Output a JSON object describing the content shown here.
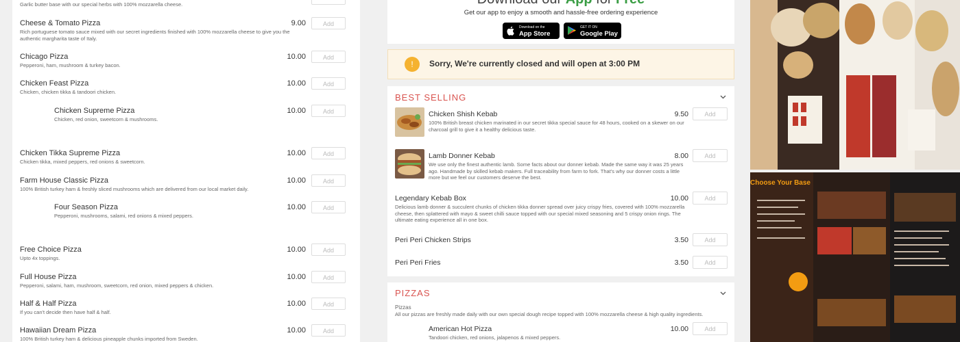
{
  "left_menu": {
    "top_desc": "Garlic butter base with our special herbs with 100% mozzarella cheese.",
    "items": [
      {
        "name": "Cheese & Tomato Pizza",
        "desc": "Rich portuguese tomato sauce mixed with our secret ingredients finished with 100% mozzarella cheese to give you the authentic margharita taste of Italy.",
        "price": "9.00",
        "add": "Add"
      },
      {
        "name": "Chicago Pizza",
        "desc": "Pepperoni, ham, mushroom & turkey bacon.",
        "price": "10.00",
        "add": "Add"
      },
      {
        "name": "Chicken Feast Pizza",
        "desc": "Chicken, chicken tikka & tandoori chicken.",
        "price": "10.00",
        "add": "Add"
      },
      {
        "name": "Chicken Supreme Pizza",
        "desc": "Chicken, red onion, sweetcorn & mushrooms.",
        "price": "10.00",
        "add": "Add"
      },
      {
        "name": "Chicken Tikka Supreme Pizza",
        "desc": "Chicken tikka, mixed peppers, red onions & sweetcorn.",
        "price": "10.00",
        "add": "Add"
      },
      {
        "name": "Farm House Classic Pizza",
        "desc": "100% British turkey ham & freshly sliced mushrooms which are delivered from our local market daily.",
        "price": "10.00",
        "add": "Add"
      },
      {
        "name": "Four Season Pizza",
        "desc": "Pepperoni, mushrooms, salami, red onions & mixed peppers.",
        "price": "10.00",
        "add": "Add"
      },
      {
        "name": "Free Choice Pizza",
        "desc": "Upto 4x toppings.",
        "price": "10.00",
        "add": "Add"
      },
      {
        "name": "Full House Pizza",
        "desc": "Pepperoni, salami, ham, mushroom, sweetcorn, red onion, mixed peppers & chicken.",
        "price": "10.00",
        "add": "Add"
      },
      {
        "name": "Half & Half Pizza",
        "desc": "If you can't decide then have half & half.",
        "price": "10.00",
        "add": "Add"
      },
      {
        "name": "Hawaiian Dream Pizza",
        "desc": "100% British turkey ham & delicious pineapple chunks imported from Sweden.",
        "price": "10.00",
        "add": "Add"
      }
    ]
  },
  "app_promo": {
    "title_prefix": "Download our",
    "title_app": "App",
    "title_for": "for",
    "title_free": "Free",
    "subtitle": "Get our app to enjoy a smooth and hassle-free ordering experience",
    "appstore_small": "Download on the",
    "appstore_big": "App Store",
    "googleplay_small": "GET IT ON",
    "googleplay_big": "Google Play"
  },
  "closed_notice": {
    "icon": "!",
    "text": "Sorry, We're currently closed and will open at 3:00 PM"
  },
  "best_selling": {
    "title": "BEST SELLING",
    "items": [
      {
        "name": "Chicken Shish Kebab",
        "desc": "100% British breast chicken marinated in our secret tikka special sauce for 48 hours, cooked on a skewer on our charcoal grill to give it a healthy delicious taste.",
        "price": "9.50",
        "add": "Add"
      },
      {
        "name": "Lamb Donner Kebab",
        "desc": "We use only the finest authentic lamb. Some facts about our donner kebab. Made the same way it was 25 years ago. Handmade by skilled kebab makers. Full traceability from farm to fork. That's why our donner costs a little more but we feel our customers deserve the best.",
        "price": "8.00",
        "add": "Add"
      },
      {
        "name": "Legendary Kebab Box",
        "desc": "Delicious lamb donner & succulent chunks of chicken tikka donner spread over juicy crispy fries, covered with 100% mozzarella cheese, then splattered with mayo & sweet chilli sauce topped with our special mixed seasoning and 5 crispy onion rings. The ultimate eating experience all in one box.",
        "price": "10.00",
        "add": "Add"
      },
      {
        "name": "Peri Peri Chicken Strips",
        "desc": "",
        "price": "3.50",
        "add": "Add"
      },
      {
        "name": "Peri Peri Fries",
        "desc": "",
        "price": "3.50",
        "add": "Add"
      }
    ]
  },
  "pizzas": {
    "title": "PIZZAS",
    "sub_title": "Pizzas",
    "sub_desc": "All our pizzas are freshly made daily with our own special dough recipe topped with 100% mozzarella cheese & high quality ingredients.",
    "items": [
      {
        "name": "American Hot Pizza",
        "desc": "Tandoori chicken, red onions, jalapenos & mixed peppers.",
        "price": "10.00",
        "add": "Add"
      }
    ]
  },
  "photo_menu_board": {
    "heading": "Choose Your Base"
  },
  "colors": {
    "accent_red": "#d9534f",
    "app_green": "#3a9d44",
    "notice_bg": "#fdf5e6",
    "notice_icon": "#f5b230"
  }
}
